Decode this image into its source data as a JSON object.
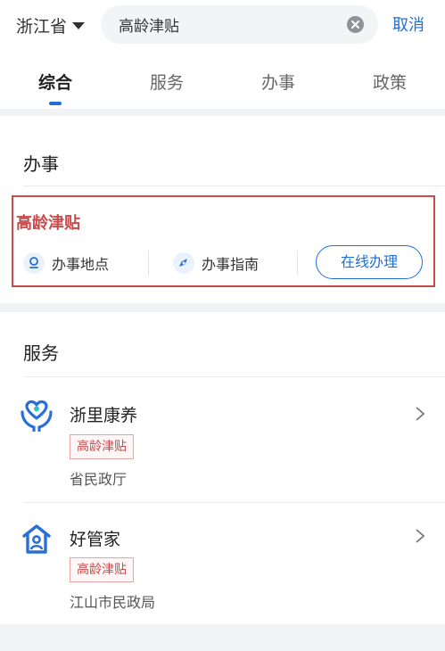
{
  "header": {
    "province": "浙江省",
    "search_value": "高龄津贴",
    "cancel_label": "取消"
  },
  "tabs": [
    {
      "label": "综合",
      "active": true
    },
    {
      "label": "服务",
      "active": false
    },
    {
      "label": "办事",
      "active": false
    },
    {
      "label": "政策",
      "active": false
    }
  ],
  "affairs": {
    "section_title": "办事",
    "item_title": "高龄津贴",
    "location_label": "办事地点",
    "guide_label": "办事指南",
    "online_button": "在线办理"
  },
  "services": {
    "section_title": "服务",
    "items": [
      {
        "name": "浙里康养",
        "tag": "高龄津贴",
        "org": "省民政厅",
        "icon": "heart-hands-icon"
      },
      {
        "name": "好管家",
        "tag": "高龄津贴",
        "org": "江山市民政局",
        "icon": "house-person-icon"
      }
    ]
  },
  "colors": {
    "accent": "#1f6fd6",
    "highlight_red": "#c84a4a"
  }
}
